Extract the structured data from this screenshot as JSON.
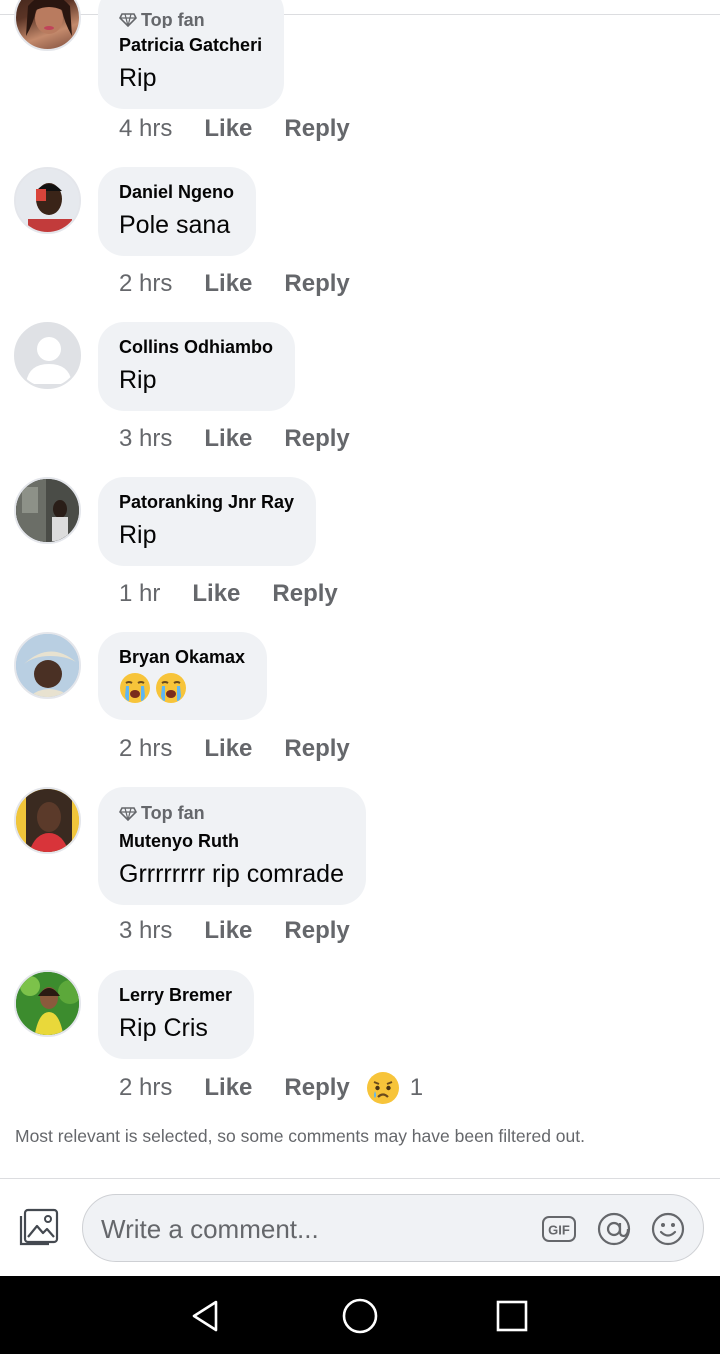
{
  "comments": [
    {
      "badge": "Top fan",
      "author": "Patricia Gatcheri",
      "text": "Rip",
      "time": "4 hrs",
      "like": "Like",
      "reply": "Reply"
    },
    {
      "author": "Daniel Ngeno",
      "text": "Pole sana",
      "time": "2 hrs",
      "like": "Like",
      "reply": "Reply"
    },
    {
      "author": "Collins Odhiambo",
      "text": "Rip",
      "time": "3 hrs",
      "like": "Like",
      "reply": "Reply"
    },
    {
      "author": "Patoranking Jnr Ray",
      "text": "Rip",
      "time": "1 hr",
      "like": "Like",
      "reply": "Reply"
    },
    {
      "author": "Bryan Okamax",
      "emojis": [
        "loudly-crying-face",
        "loudly-crying-face"
      ],
      "time": "2 hrs",
      "like": "Like",
      "reply": "Reply"
    },
    {
      "badge": "Top fan",
      "author": "Mutenyo Ruth",
      "text": "Grrrrrrrr rip comrade",
      "time": "3 hrs",
      "like": "Like",
      "reply": "Reply"
    },
    {
      "author": "Lerry Bremer",
      "text": "Rip Cris",
      "time": "2 hrs",
      "like": "Like",
      "reply": "Reply",
      "reaction": {
        "icon": "sad-face",
        "count": "1"
      }
    }
  ],
  "filter_note": "Most relevant is selected, so some comments may have been filtered out.",
  "composer": {
    "placeholder": "Write a comment...",
    "icons": [
      "photo-icon",
      "gif-icon",
      "mention-icon",
      "emoji-icon"
    ]
  },
  "navbar": {
    "icons": [
      "back-icon",
      "home-icon",
      "recents-icon"
    ]
  },
  "colors": {
    "bubble": "#f0f2f5",
    "secondary_text": "#65676b",
    "navbar": "#000000"
  }
}
